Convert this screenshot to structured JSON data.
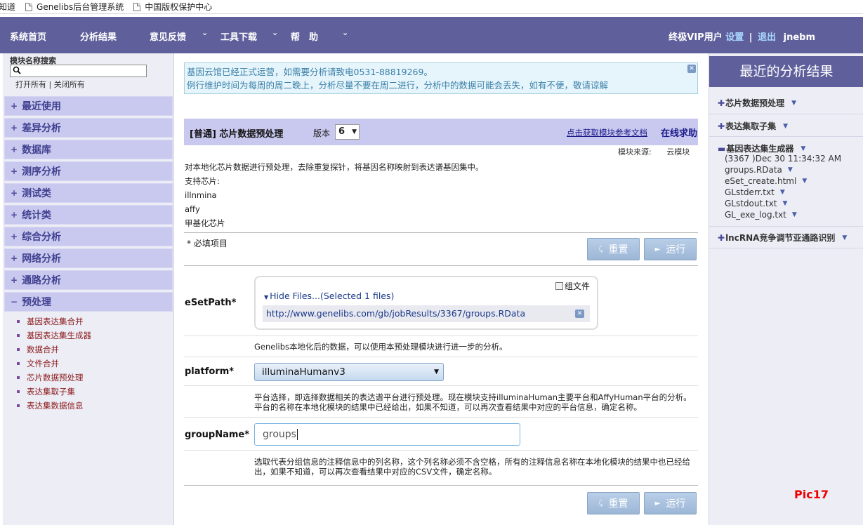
{
  "bookmarks": [
    {
      "label": "知道"
    },
    {
      "label": "Genelibs后台管理系统"
    },
    {
      "label": "中国版权保护中心"
    }
  ],
  "nav": {
    "home": "系统首页",
    "analysis_results": "分析结果",
    "feedback": "意见反馈",
    "tools": "工具下载",
    "help": "帮　助",
    "vip_user": "终极VIP用户",
    "settings": "设置",
    "logout": "退出",
    "username": "jnebm"
  },
  "sidebar": {
    "search_label": "模块名称搜索",
    "search_value": "",
    "open_all": "打开所有",
    "close_all": "关闭所有",
    "categories": [
      {
        "sym": "+",
        "label": "最近使用"
      },
      {
        "sym": "+",
        "label": "差异分析"
      },
      {
        "sym": "+",
        "label": "数据库"
      },
      {
        "sym": "+",
        "label": "测序分析"
      },
      {
        "sym": "+",
        "label": "测试类"
      },
      {
        "sym": "+",
        "label": "统计类"
      },
      {
        "sym": "+",
        "label": "综合分析"
      },
      {
        "sym": "+",
        "label": "网络分析"
      },
      {
        "sym": "+",
        "label": "通路分析"
      },
      {
        "sym": "−",
        "label": "预处理"
      }
    ],
    "preprocess_items": [
      "基因表达集合并",
      "基因表达集生成器",
      "数据合并",
      "文件合并",
      "芯片数据预处理",
      "表达集取子集",
      "表达集数据信息"
    ]
  },
  "notice": {
    "line1": "基因云馆已经正式运营，如需要分析请致电0531-88819269。",
    "line2": "例行维护时间为每周的周二晚上，分析尽量不要在周二进行，分析中的数据可能会丢失，如有不便，敬请谅解"
  },
  "module": {
    "title": "[普通] 芯片数据预处理",
    "version_label": "版本",
    "version_value": "6",
    "doc_link": "点击获取模块参考文档",
    "online_help": "在线求助",
    "source_label": "模块来源:",
    "source_value": "云模块",
    "description": [
      "对本地化芯片数据进行预处理，去除重复探针，将基因名称映射到表达谱基因集中。",
      "支持芯片:",
      "illnmina",
      "affy",
      "甲基化芯片"
    ],
    "required_note": "* 必填项目"
  },
  "buttons": {
    "reset": "重置",
    "run": "运行"
  },
  "fields": {
    "esetpath": {
      "label": "eSetPath*",
      "group_files": "组文件",
      "hide_files": "Hide Files...(Selected 1 files)",
      "file_url": "http://www.genelibs.com/gb/jobResults/3367/groups.RData",
      "help": "Genelibs本地化后的数据，可以使用本预处理模块进行进一步的分析。"
    },
    "platform": {
      "label": "platform*",
      "value": "illuminaHumanv3",
      "help": "平台选择，即选择数据相关的表达谱平台进行预处理。现在模块支持illuminaHuman主要平台和AffyHuman平台的分析。平台的名称在本地化模块的结果中已经给出，如果不知道，可以再次查看结果中对应的平台信息，确定名称。"
    },
    "groupname": {
      "label": "groupName*",
      "value": "groups",
      "help": "选取代表分组信息的注释信息中的列名称，这个列名称必须不含空格，所有的注释信息名称在本地化模块的结果中也已经给出，如果不知道，可以再次查看结果中对应的CSV文件，确定名称。"
    }
  },
  "recent": {
    "title": "最近的分析结果",
    "items": [
      {
        "label": "芯片数据预处理"
      },
      {
        "label": "表达集取子集"
      },
      {
        "label": "基因表达集生成器"
      },
      {
        "label": "lncRNA竞争调节亚通路识别"
      }
    ],
    "job_info": "(3367 )Dec 30 11:34:32 AM",
    "files": [
      "groups.RData",
      "eSet_create.html",
      "GLstderr.txt",
      "GLstdout.txt",
      "GL_exe_log.txt"
    ]
  },
  "pic_label": "Pic17",
  "colors": {
    "nav_bg": "#5f5f9c",
    "category_bg": "#c9c9f0",
    "notice_bg": "#e6f5fb",
    "button_bg": "#9cb6d6",
    "pic_label": "#ee0000"
  }
}
